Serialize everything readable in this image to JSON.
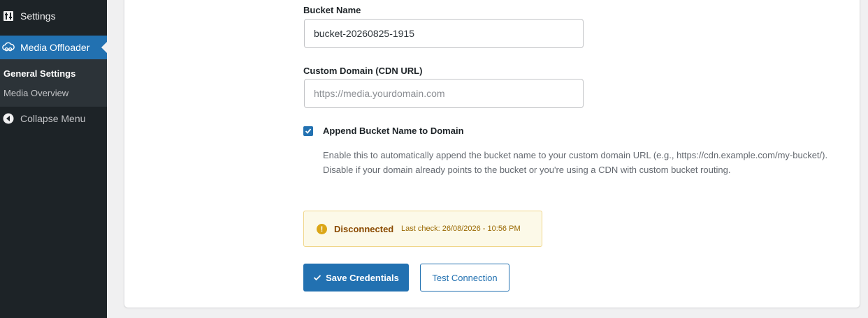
{
  "sidebar": {
    "settings_label": "Settings",
    "media_offloader_label": "Media Offloader",
    "submenu": {
      "general_settings": "General Settings",
      "media_overview": "Media Overview"
    },
    "collapse_label": "Collapse Menu"
  },
  "form": {
    "bucket_name": {
      "label": "Bucket Name",
      "value": "bucket-20260825-1915"
    },
    "custom_domain": {
      "label": "Custom Domain (CDN URL)",
      "placeholder": "https://media.yourdomain.com"
    },
    "append_bucket": {
      "label": "Append Bucket Name to Domain",
      "checked": true,
      "help_line1": "Enable this to automatically append the bucket name to your custom domain URL (e.g., https://cdn.example.com/my-bucket/).",
      "help_line2": "Disable if your domain already points to the bucket or you're using a CDN with custom bucket routing."
    }
  },
  "status": {
    "text": "Disconnected",
    "last_check": "Last check: 26/08/2026 - 10:56 PM"
  },
  "actions": {
    "save_label": "Save Credentials",
    "test_label": "Test Connection"
  },
  "colors": {
    "accent": "#2271b1",
    "sidebar": "#1d2327",
    "warning_bg": "#fcf9e8"
  }
}
